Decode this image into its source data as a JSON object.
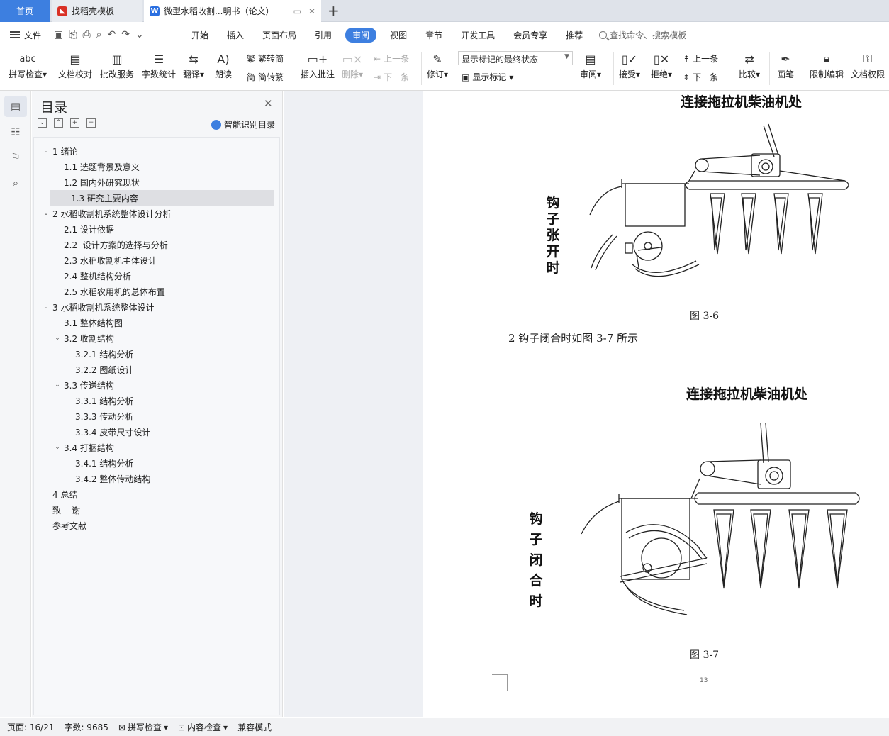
{
  "tabs": {
    "home": "首页",
    "template": "找稻壳模板",
    "document": "微型水稻收割...明书（论文）",
    "new_tab": "+"
  },
  "menu": {
    "file": "文件",
    "items": [
      "开始",
      "插入",
      "页面布局",
      "引用",
      "审阅",
      "视图",
      "章节",
      "开发工具",
      "会员专享",
      "推荐"
    ],
    "active": "审阅",
    "search": "查找命令、搜索模板"
  },
  "ribbon": {
    "spell": "拼写检查",
    "proof": "文档校对",
    "batch": "批改服务",
    "wordcount": "字数统计",
    "translate": "翻译",
    "read": "朗读",
    "trad": "繁转简",
    "simp": "简转繁",
    "insert_comment": "插入批注",
    "delete": "删除",
    "prev": "上一条",
    "next": "下一条",
    "track": "修订",
    "markup_state": "显示标记的最终状态",
    "show_markup": "显示标记",
    "review": "审阅",
    "accept": "接受",
    "reject": "拒绝",
    "prev2": "上一条",
    "next2": "下一条",
    "compare": "比较",
    "pen": "画笔",
    "restrict": "限制编辑",
    "permission": "文档权限"
  },
  "toc": {
    "title": "目录",
    "smart": "智能识别目录",
    "items": [
      {
        "label": "1 绪论",
        "toggle": "v"
      },
      {
        "label": "1.1 选题背景及意义",
        "toggle": ""
      },
      {
        "label": "1.2 国内外研究现状",
        "toggle": ""
      },
      {
        "label": "1.3 研究主要内容",
        "toggle": ""
      },
      {
        "label": "2 水稻收割机系统整体设计分析",
        "toggle": "v"
      },
      {
        "label": "2.1 设计依据",
        "toggle": ""
      },
      {
        "label": "2.2  设计方案的选择与分析",
        "toggle": ""
      },
      {
        "label": "2.3 水稻收割机主体设计",
        "toggle": ""
      },
      {
        "label": "2.4 整机结构分析",
        "toggle": ""
      },
      {
        "label": "2.5 水稻农用机的总体布置",
        "toggle": ""
      },
      {
        "label": "3 水稻收割机系统整体设计",
        "toggle": "v"
      },
      {
        "label": "3.1 整体结构图",
        "toggle": ""
      },
      {
        "label": "3.2 收割结构",
        "toggle": "v"
      },
      {
        "label": "3.2.1 结构分析",
        "toggle": ""
      },
      {
        "label": "3.2.2 图纸设计",
        "toggle": ""
      },
      {
        "label": "3.3 传送结构",
        "toggle": "v"
      },
      {
        "label": "3.3.1 结构分析",
        "toggle": ""
      },
      {
        "label": "3.3.3 传动分析",
        "toggle": ""
      },
      {
        "label": "3.3.4 皮带尺寸设计",
        "toggle": ""
      },
      {
        "label": "3.4 打捆结构",
        "toggle": "v"
      },
      {
        "label": "3.4.1 结构分析",
        "toggle": ""
      },
      {
        "label": "3.4.2 整体传动结构",
        "toggle": ""
      },
      {
        "label": "4 总结",
        "toggle": ""
      },
      {
        "label": "致    谢",
        "toggle": ""
      },
      {
        "label": "参考文献",
        "toggle": ""
      }
    ]
  },
  "document": {
    "fig1_top_label": "连接拖拉机柴油机处",
    "fig1_side_label": [
      "钩",
      "子",
      "张",
      "开",
      "时"
    ],
    "fig1_caption": "图 3-6",
    "paragraph": "2 钩子闭合时如图 3-7 所示",
    "fig2_top_label": "连接拖拉机柴油机处",
    "fig2_side_label": [
      "钩",
      "子",
      "闭",
      "合",
      "时"
    ],
    "fig2_caption": "图 3-7",
    "page_number": "13"
  },
  "status": {
    "page": "页面: 16/21",
    "words": "字数: 9685",
    "spell": "拼写检查",
    "content_check": "内容检查",
    "compat": "兼容模式"
  },
  "colors": {
    "accent": "#3d7fe0",
    "panel_bg": "#f5f6f8",
    "canvas_bg": "#eef0f4"
  }
}
